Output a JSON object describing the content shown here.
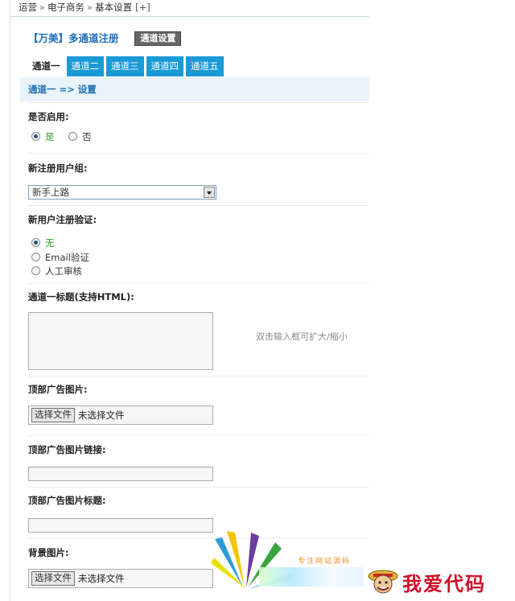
{
  "breadcrumb": {
    "items": [
      "运营",
      "电子商务",
      "基本设置"
    ],
    "separator": "»",
    "expand": "[+]"
  },
  "header": {
    "title": "【万美】多通道注册",
    "badge": "通道设置"
  },
  "tabs": [
    {
      "label": "通道一",
      "active": true
    },
    {
      "label": "通道二",
      "active": false
    },
    {
      "label": "通道三",
      "active": false
    },
    {
      "label": "通道四",
      "active": false
    },
    {
      "label": "通道五",
      "active": false
    }
  ],
  "section_heading": "通道一 => 设置",
  "fields": {
    "enable": {
      "label": "是否启用:",
      "options": [
        "是",
        "否"
      ],
      "selected": "是"
    },
    "usergroup": {
      "label": "新注册用户组:",
      "value": "新手上路"
    },
    "verify": {
      "label": "新用户注册验证:",
      "options": [
        "无",
        "Email验证",
        "人工审核"
      ],
      "selected": "无"
    },
    "channel_title": {
      "label": "通道一标题(支持HTML):",
      "value": "",
      "hint": "双击输入框可扩大/缩小"
    },
    "top_ad_image": {
      "label": "顶部广告图片:",
      "button": "选择文件",
      "status": "未选择文件"
    },
    "top_ad_link": {
      "label": "顶部广告图片链接:",
      "value": ""
    },
    "top_ad_title": {
      "label": "顶部广告图片标题:",
      "value": ""
    },
    "bg_image": {
      "label": "背景图片:",
      "button": "选择文件",
      "status": "未选择文件"
    }
  },
  "watermark": {
    "tagline": "专注网站源码",
    "brand": "我爱代码"
  },
  "colors": {
    "tab_idle": "#1b9ad8",
    "link_blue": "#1e6fb2",
    "subhead_bg": "#e8f3fb",
    "selected_green": "#2e9b2e"
  }
}
